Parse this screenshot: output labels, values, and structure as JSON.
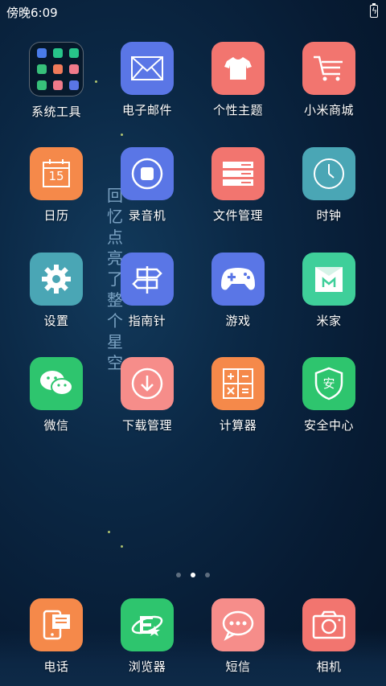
{
  "status_bar": {
    "time": "傍晚6:09"
  },
  "decor_text": "回忆点亮了整个星空",
  "apps": [
    {
      "label": "系统工具"
    },
    {
      "label": "电子邮件"
    },
    {
      "label": "个性主题"
    },
    {
      "label": "小米商城"
    },
    {
      "label": "日历",
      "calendar_day": "15"
    },
    {
      "label": "录音机"
    },
    {
      "label": "文件管理"
    },
    {
      "label": "时钟"
    },
    {
      "label": "设置"
    },
    {
      "label": "指南针"
    },
    {
      "label": "游戏"
    },
    {
      "label": "米家"
    },
    {
      "label": "微信"
    },
    {
      "label": "下载管理"
    },
    {
      "label": "计算器"
    },
    {
      "label": "安全中心",
      "badge": "安"
    }
  ],
  "page_indicator": {
    "pages": 3,
    "active": 2
  },
  "dock": [
    {
      "label": "电话"
    },
    {
      "label": "浏览器"
    },
    {
      "label": "短信"
    },
    {
      "label": "相机"
    }
  ],
  "colors": {
    "blue": "#5a76e6",
    "salmon": "#f2756f",
    "orange": "#f5894a",
    "teal": "#4aa6b5",
    "green": "#2ec56e",
    "mint": "#3fcf9a"
  }
}
